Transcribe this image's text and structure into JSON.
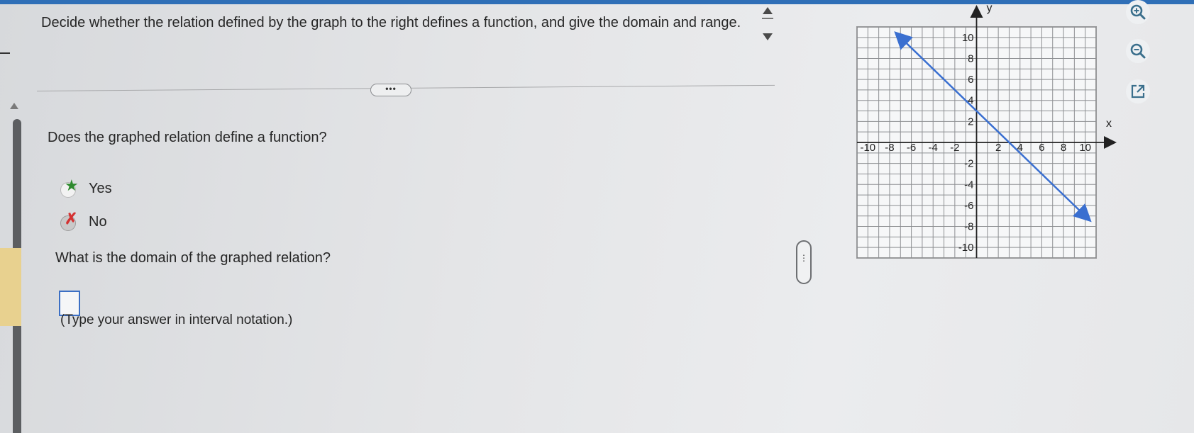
{
  "question": {
    "prompt": "Decide whether the relation defined by the graph to the right defines a function, and give the domain and range."
  },
  "divider": {
    "more_label": "•••"
  },
  "part1": {
    "question": "Does the graphed relation define a function?",
    "options": [
      {
        "label": "Yes",
        "state": "correct"
      },
      {
        "label": "No",
        "state": "incorrect"
      }
    ]
  },
  "part2": {
    "question": "What is the domain of the graphed relation?",
    "answer": "",
    "hint": "(Type your answer in interval notation.)"
  },
  "graph": {
    "x_axis_label": "x",
    "y_axis_label": "y",
    "x_ticks": [
      "-10",
      "-8",
      "-6",
      "-4",
      "-2",
      "2",
      "4",
      "6",
      "8",
      "10"
    ],
    "y_ticks": [
      "10",
      "8",
      "6",
      "4",
      "2",
      "-2",
      "-4",
      "-6",
      "-8",
      "-10"
    ],
    "line": {
      "from": [
        -7,
        10
      ],
      "to": [
        10,
        -7
      ],
      "color": "#3a6fd0",
      "arrows": "both"
    }
  },
  "toolbar": {
    "icons": [
      "zoom-in-icon",
      "zoom-out-icon",
      "popout-icon"
    ]
  },
  "colors": {
    "accent": "#2f6fb7",
    "correct": "#2e8a2e",
    "incorrect": "#d43232"
  }
}
